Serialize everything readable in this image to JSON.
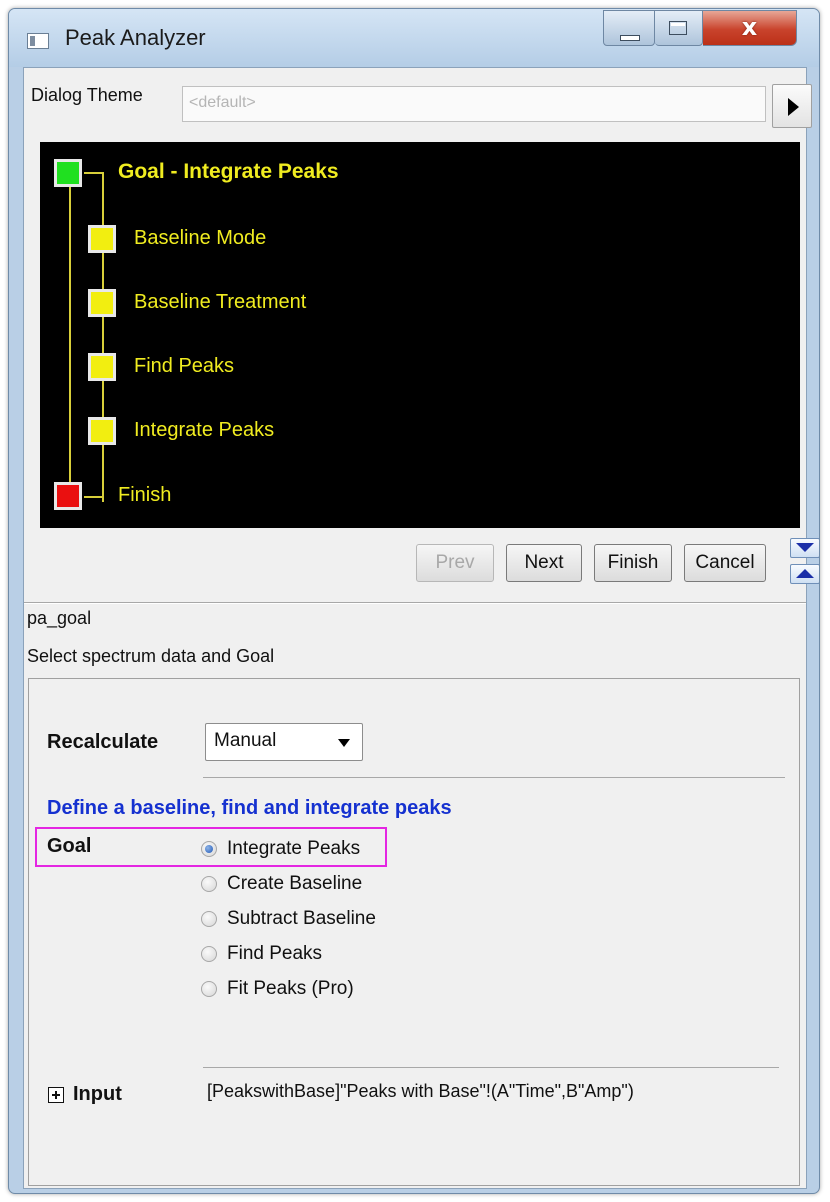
{
  "window": {
    "title": "Peak Analyzer",
    "close_glyph": "x"
  },
  "theme": {
    "label": "Dialog Theme",
    "value": "<default>"
  },
  "tree": {
    "root": "Goal - Integrate Peaks",
    "items": [
      "Baseline Mode",
      "Baseline Treatment",
      "Find Peaks",
      "Integrate Peaks"
    ],
    "finish": "Finish",
    "colors": {
      "root": "#20e020",
      "item": "#f2ee10",
      "finish": "#ea1010",
      "text": "#f0ec20",
      "background": "#000000"
    }
  },
  "nav": {
    "prev": "Prev",
    "next": "Next",
    "finish": "Finish",
    "cancel": "Cancel"
  },
  "page": {
    "function_name": "pa_goal",
    "description": "Select spectrum data and Goal"
  },
  "settings": {
    "recalculate_label": "Recalculate",
    "recalculate_value": "Manual",
    "section_title": "Define a baseline, find and integrate peaks",
    "goal_label": "Goal",
    "goal_options": [
      "Integrate Peaks",
      "Create Baseline",
      "Subtract Baseline",
      "Find Peaks",
      "Fit Peaks (Pro)"
    ],
    "goal_selected": "Integrate Peaks",
    "input_label": "Input",
    "input_value": "[PeakswithBase]\"Peaks with Base\"!(A\"Time\",B\"Amp\")"
  },
  "icons": [
    "app-icon",
    "minimize-icon",
    "maximize-icon",
    "close-icon",
    "arrow-right-icon",
    "scroll-down-icon",
    "scroll-up-icon",
    "expand-plus-icon"
  ]
}
